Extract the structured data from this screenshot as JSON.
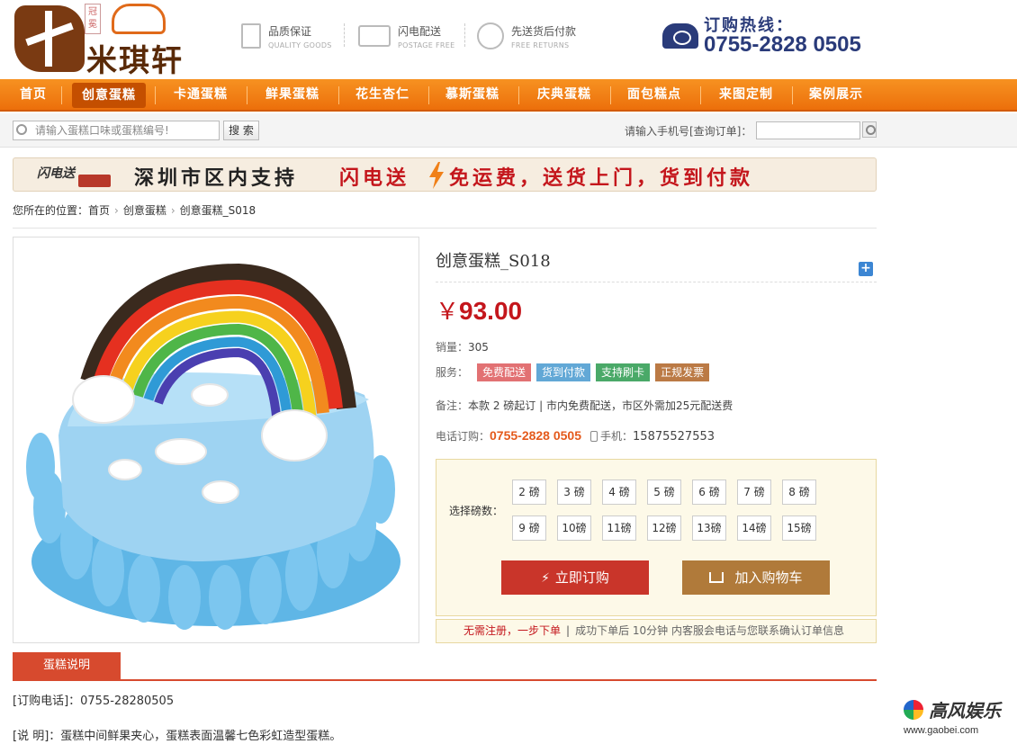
{
  "brand": {
    "name": "米琪轩",
    "seal": "冠冕",
    "logo_char": "米"
  },
  "services": [
    {
      "title": "品质保证",
      "sub": "QUALITY GOODS",
      "icon": "bookmark-icon"
    },
    {
      "title": "闪电配送",
      "sub": "POSTAGE FREE",
      "icon": "truck-icon"
    },
    {
      "title": "先送货后付款",
      "sub": "FREE RETURNS",
      "icon": "refresh-icon"
    }
  ],
  "hotline": {
    "label": "订购热线：",
    "number": "0755-2828 0505"
  },
  "nav": [
    "首页",
    "创意蛋糕",
    "卡通蛋糕",
    "鲜果蛋糕",
    "花生杏仁",
    "慕斯蛋糕",
    "庆典蛋糕",
    "面包糕点",
    "来图定制",
    "案例展示"
  ],
  "nav_active": "创意蛋糕",
  "search": {
    "placeholder": "请输入蛋糕口味或蛋糕编号!",
    "button": "搜 索",
    "order_label": "请输入手机号[查询订单]："
  },
  "banner": {
    "logo": "闪电送",
    "t1": "深圳市区内支持",
    "t2": "闪电送",
    "t3": "免运费，送货上门，货到付款"
  },
  "breadcrumb": {
    "prefix": "您所在的位置：",
    "items": [
      "首页",
      "创意蛋糕",
      "创意蛋糕_S018"
    ]
  },
  "product": {
    "title": "创意蛋糕_S018",
    "currency": "￥",
    "price": "93.00",
    "sales_label": "销量：",
    "sales": "305",
    "service_label": "服务：",
    "tags": [
      "免费配送",
      "货到付款",
      "支持刷卡",
      "正规发票"
    ],
    "note_label": "备注：",
    "note": "本款 2 磅起订 | 市内免费配送，市区外需加25元配送费",
    "phone_label": "电话订购：",
    "phone": "0755-2828 0505",
    "mobile_label": "手机：",
    "mobile": "15875527553"
  },
  "size_select": {
    "label": "选择磅数：",
    "options": [
      "2 磅",
      "3 磅",
      "4 磅",
      "5 磅",
      "6 磅",
      "7 磅",
      "8 磅",
      "9 磅",
      "10磅",
      "11磅",
      "12磅",
      "13磅",
      "14磅",
      "15磅"
    ]
  },
  "actions": {
    "buy": "立即订购",
    "cart": "加入购物车"
  },
  "notice": {
    "highlight": "无需注册，一步下单",
    "sep": "|",
    "text": "成功下单后 10分钟  内客服会电话与您联系确认订单信息"
  },
  "detail": {
    "tab": "蛋糕说明",
    "line1": "[订购电话]：0755-28280505",
    "line2": "[说 明]：蛋糕中间鲜果夹心，蛋糕表面温馨七色彩虹造型蛋糕。"
  },
  "watermark": {
    "name": "高风娱乐",
    "url": "www.gaobei.com"
  },
  "colors": {
    "nav": "#f08018",
    "price": "#c4161c",
    "buy": "#c9352a",
    "cart": "#b07a3a",
    "tab": "#d74a2e"
  }
}
